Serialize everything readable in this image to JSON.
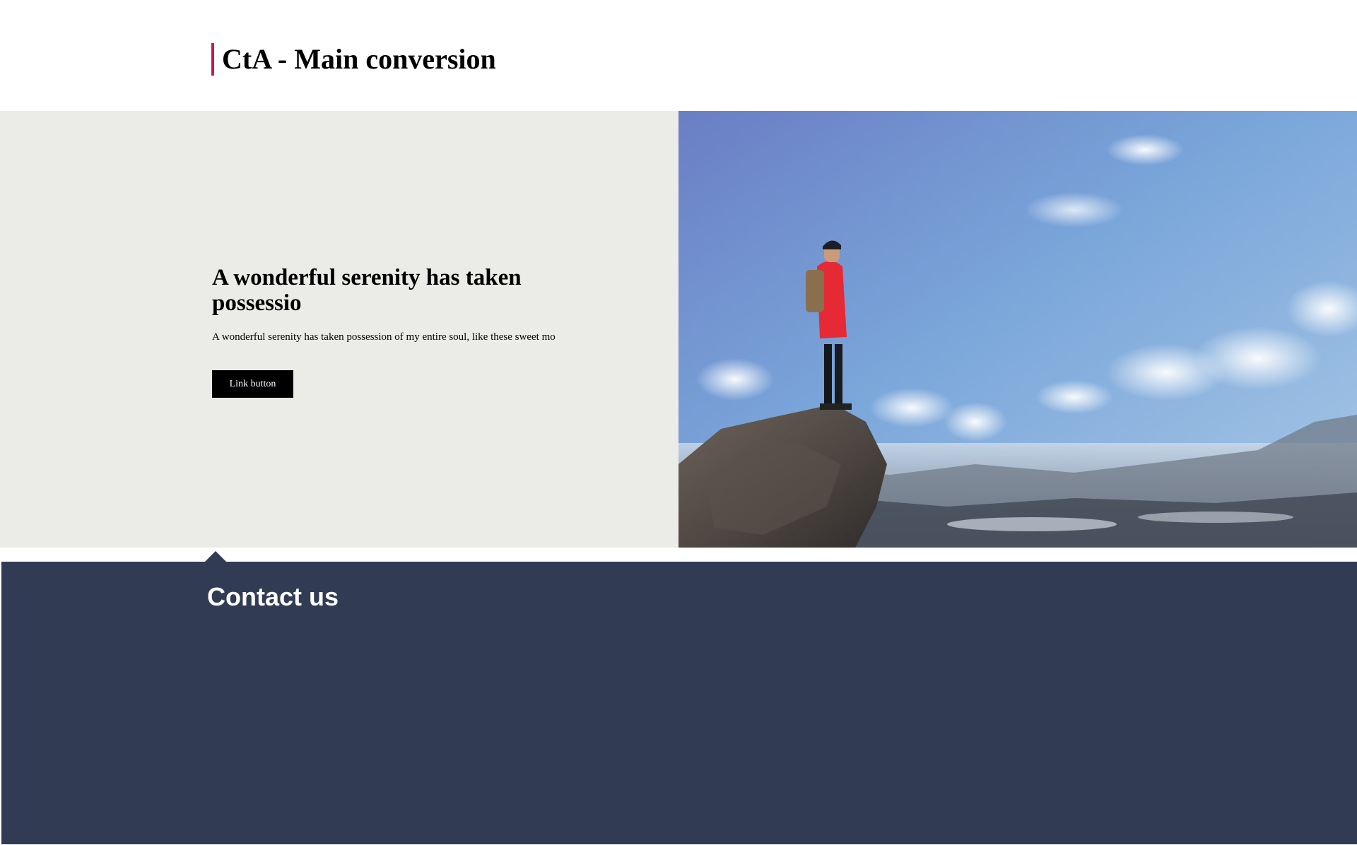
{
  "header": {
    "title": "CtA - Main conversion",
    "accent_color": "#d0154e"
  },
  "hero": {
    "heading": "A wonderful serenity has taken possessio",
    "text": "A wonderful serenity has taken possession of my entire soul, like these sweet mo",
    "button_label": "Link button",
    "background_color": "#ebebe7",
    "image_subject": "hiker-on-cliff-photo"
  },
  "contact": {
    "title": "Contact us",
    "background_color": "#313b54"
  }
}
